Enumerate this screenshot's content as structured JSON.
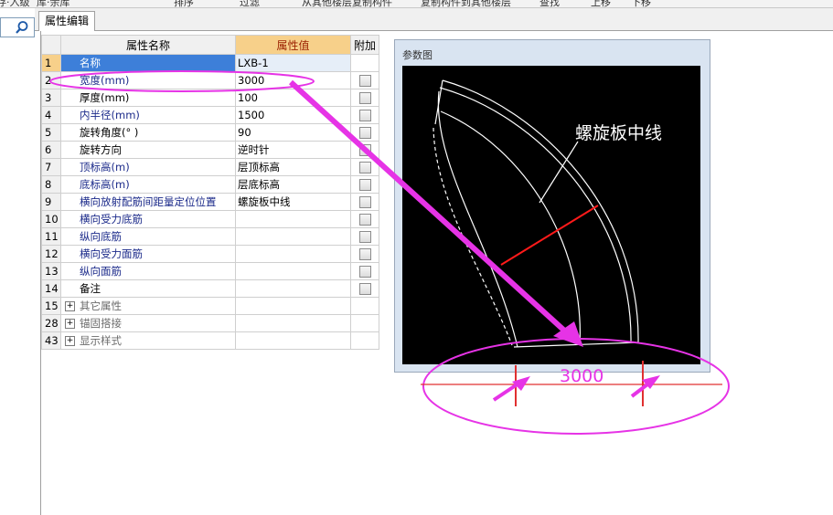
{
  "toolbar": {
    "items": [
      "存·入级",
      "库·余库",
      "排序",
      "过滤",
      "从其他楼层复制构件",
      "复制构件到其他楼层",
      "查找",
      "上移",
      "下移"
    ]
  },
  "tab": {
    "label": "属性编辑"
  },
  "grid": {
    "headers": {
      "name": "属性名称",
      "value": "属性值",
      "extra": "附加"
    },
    "rows": [
      {
        "no": "1",
        "name": "名称",
        "value": "LXB-1"
      },
      {
        "no": "2",
        "name": "宽度(mm)",
        "value": "3000"
      },
      {
        "no": "3",
        "name": "厚度(mm)",
        "value": "100"
      },
      {
        "no": "4",
        "name": "内半径(mm)",
        "value": "1500"
      },
      {
        "no": "5",
        "name": "旋转角度(° )",
        "value": "90"
      },
      {
        "no": "6",
        "name": "旋转方向",
        "value": "逆时针"
      },
      {
        "no": "7",
        "name": "顶标高(m)",
        "value": "层顶标高"
      },
      {
        "no": "8",
        "name": "底标高(m)",
        "value": "层底标高"
      },
      {
        "no": "9",
        "name": "横向放射配筋间距量定位位置",
        "value": "螺旋板中线"
      },
      {
        "no": "10",
        "name": "横向受力底筋",
        "value": ""
      },
      {
        "no": "11",
        "name": "纵向底筋",
        "value": ""
      },
      {
        "no": "12",
        "name": "横向受力面筋",
        "value": ""
      },
      {
        "no": "13",
        "name": "纵向面筋",
        "value": ""
      },
      {
        "no": "14",
        "name": "备注",
        "value": ""
      }
    ],
    "groups": [
      {
        "no": "15",
        "name": "其它属性"
      },
      {
        "no": "28",
        "name": "锚固搭接"
      },
      {
        "no": "43",
        "name": "显示样式"
      }
    ]
  },
  "param_panel": {
    "title": "参数图",
    "centerline_label": "螺旋板中线",
    "width_dimension": "3000"
  },
  "colors": {
    "highlight": "#e633e6",
    "selection": "#3d7fd9",
    "value_header": "#f7d08a",
    "red_line": "#ff1a1a"
  }
}
